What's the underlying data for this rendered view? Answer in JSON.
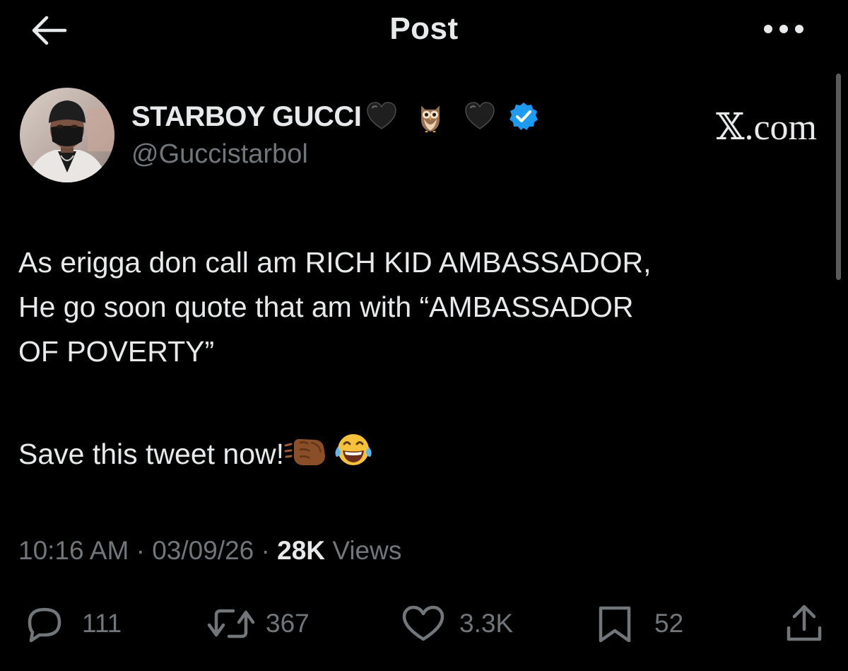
{
  "header": {
    "title": "Post",
    "back_icon": "arrow-left-icon",
    "more_icon": "more-horizontal-icon"
  },
  "author": {
    "name": "STARBOY GUCCI",
    "name_icons": [
      "black-heart-icon",
      "owl-emoji-icon",
      "black-heart-icon",
      "verified-badge-icon"
    ],
    "handle": "@Guccistarbol",
    "avatar": "avatar-image",
    "verified_color": "#1d9bf0"
  },
  "watermark": "𝕏.com",
  "tweet": {
    "lines": [
      "As erigga don call am RICH KID AMBASSADOR,",
      "He go soon quote that am with “AMBASSADOR",
      "OF POVERTY”"
    ],
    "last_line": "Save this tweet now!",
    "last_line_icons": [
      "fist-bump-emoji-icon",
      "tears-of-joy-emoji-icon"
    ]
  },
  "meta": {
    "time": "10:16 AM",
    "separator": " · ",
    "date": "03/09/26",
    "views_count": "28K",
    "views_label": "Views"
  },
  "actions": {
    "replies": "111",
    "reposts": "367",
    "likes": "3.3K",
    "bookmarks": "52",
    "icons": [
      "reply-icon",
      "repost-icon",
      "like-icon",
      "bookmark-icon",
      "share-icon"
    ]
  },
  "colors": {
    "background": "#000000",
    "text": "#e7e9ea",
    "secondary_text": "#71767b",
    "accent": "#1d9bf0"
  }
}
